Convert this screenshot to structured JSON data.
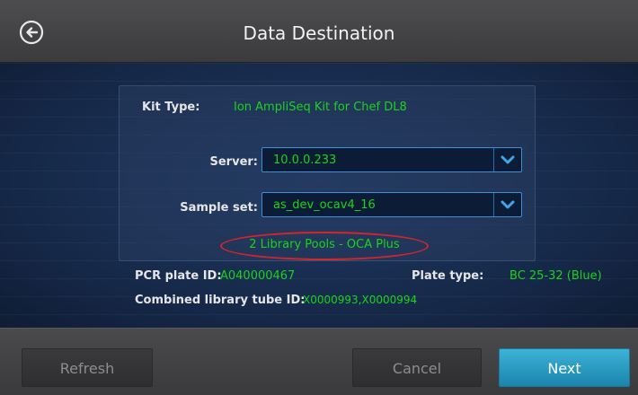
{
  "header": {
    "title": "Data Destination",
    "back_icon": "back-arrow-circle-icon"
  },
  "panel": {
    "kit_type_label": "Kit Type:",
    "kit_type_value": "Ion AmpliSeq Kit for Chef DL8",
    "server": {
      "label": "Server:",
      "selected": "10.0.0.233",
      "icon": "chevron-down-icon"
    },
    "sample_set": {
      "label": "Sample set:",
      "selected": "as_dev_ocav4_16",
      "icon": "chevron-down-icon"
    },
    "library_pools": "2 Library Pools - OCA Plus"
  },
  "info": {
    "pcr_plate_label": "PCR plate ID:",
    "pcr_plate_value": "A040000467",
    "plate_type_label": "Plate type:",
    "plate_type_value": "BC 25-32 (Blue)",
    "combined_tube_label": "Combined library tube ID:",
    "combined_tube_value": "X0000993,X0000994"
  },
  "footer": {
    "refresh_label": "Refresh",
    "cancel_label": "Cancel",
    "next_label": "Next"
  },
  "colors": {
    "value_green": "#19d419",
    "accent_blue": "#3b8fd6",
    "next_button": "#2a9fc8",
    "highlight_red": "#d3262b"
  }
}
